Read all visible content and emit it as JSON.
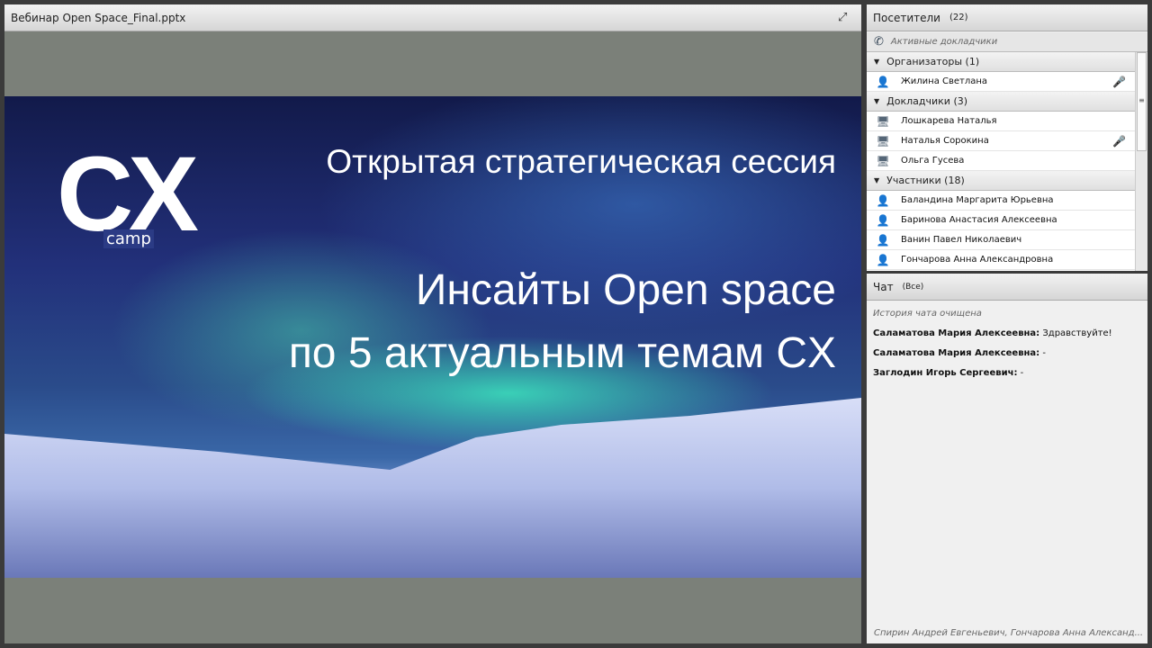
{
  "share": {
    "title": "Вебинар Open Space_Final.pptx",
    "fullscreen_icon": "fullscreen-icon"
  },
  "slide": {
    "logo": "CX",
    "logo_sub": "camp",
    "line1": "Открытая стратегическая сессия",
    "line2": "Инсайты Open space",
    "line3": "по 5 актуальным темам CX"
  },
  "attendees": {
    "title": "Посетители",
    "count": "(22)",
    "active_speakers": "Активные докладчики",
    "groups": [
      {
        "label": "Организаторы (1)",
        "members": [
          {
            "name": "Жилина Светлана",
            "mic": true
          }
        ]
      },
      {
        "label": "Докладчики (3)",
        "members": [
          {
            "name": "Лошкарева Наталья",
            "mic": false
          },
          {
            "name": "Наталья Сорокина",
            "mic": true
          },
          {
            "name": "Ольга Гусева",
            "mic": false
          }
        ]
      },
      {
        "label": "Участники (18)",
        "members": [
          {
            "name": "Баландина Маргарита Юрьевна"
          },
          {
            "name": "Баринова Анастасия Алексеевна"
          },
          {
            "name": "Ванин Павел Николаевич"
          },
          {
            "name": "Гончарова Анна Александровна"
          }
        ]
      }
    ]
  },
  "chat": {
    "title": "Чат",
    "scope": "(Все)",
    "cleared": "История чата очищена",
    "messages": [
      {
        "author": "Саламатова Мария Алексеевна:",
        "text": " Здравствуйте!"
      },
      {
        "author": "Саламатова Мария Алексеевна:",
        "text": " -"
      },
      {
        "author": "Заглодин Игорь Сергеевич:",
        "text": " -"
      }
    ],
    "typing": "Спирин Андрей Евгеньевич, Гончарова Анна Александ..."
  }
}
